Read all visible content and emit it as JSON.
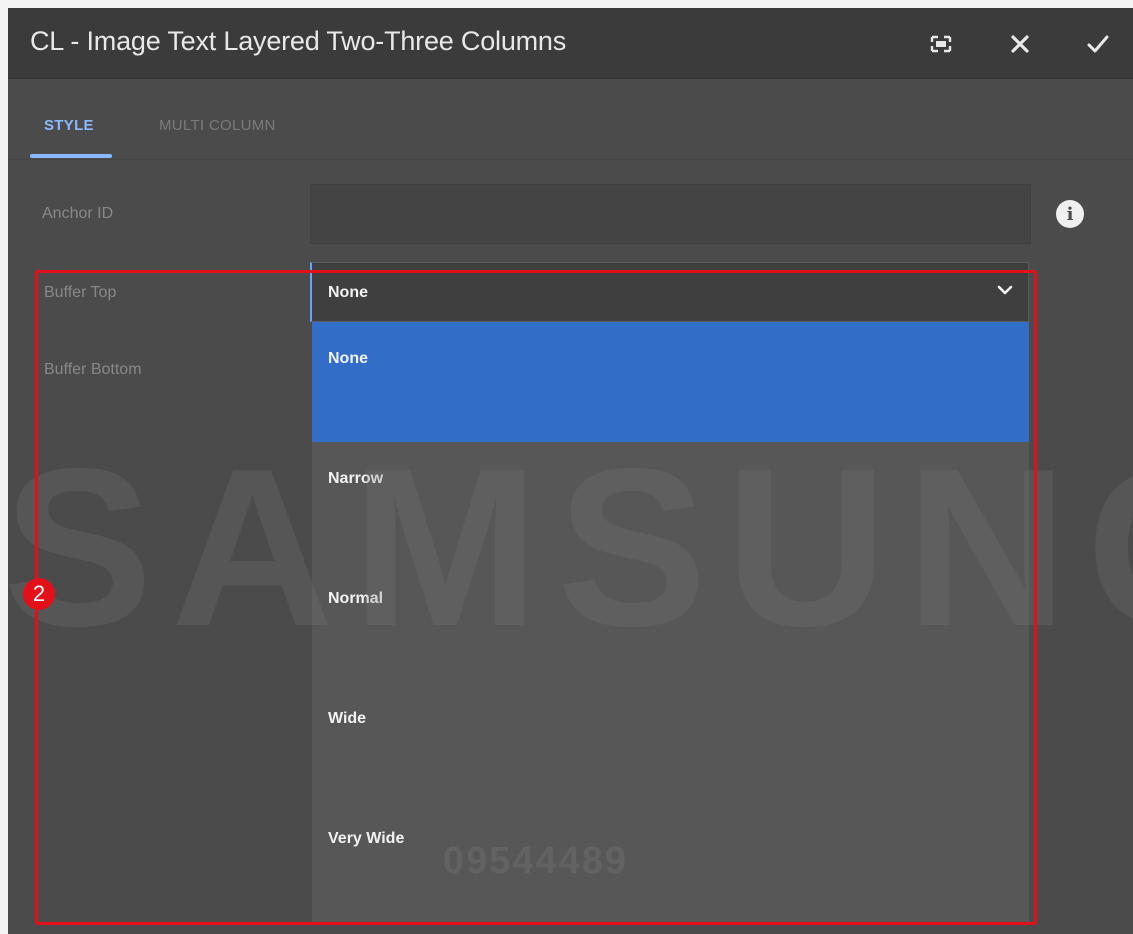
{
  "dialog": {
    "title": "CL - Image Text Layered Two-Three Columns",
    "actions": {
      "fullscreen_icon": "fullscreen-icon",
      "close_icon": "close-icon",
      "confirm_icon": "check-icon"
    }
  },
  "tabs": [
    {
      "label": "STYLE",
      "active": true
    },
    {
      "label": "MULTI COLUMN",
      "active": false
    }
  ],
  "form": {
    "anchor_id": {
      "label": "Anchor ID",
      "value": ""
    },
    "buffer_top": {
      "label": "Buffer Top",
      "value": "None"
    },
    "buffer_bottom": {
      "label": "Buffer Bottom"
    }
  },
  "dropdown": {
    "options": [
      "None",
      "Narrow",
      "Normal",
      "Wide",
      "Very Wide"
    ],
    "selected": "None"
  },
  "annotation": {
    "badge": "2"
  },
  "watermark": {
    "brand": "SAMSUNG",
    "code": "09544489"
  },
  "colors": {
    "accent": "#8ab8ff",
    "selected_option": "#326ec8",
    "annotation": "#e3101a"
  }
}
